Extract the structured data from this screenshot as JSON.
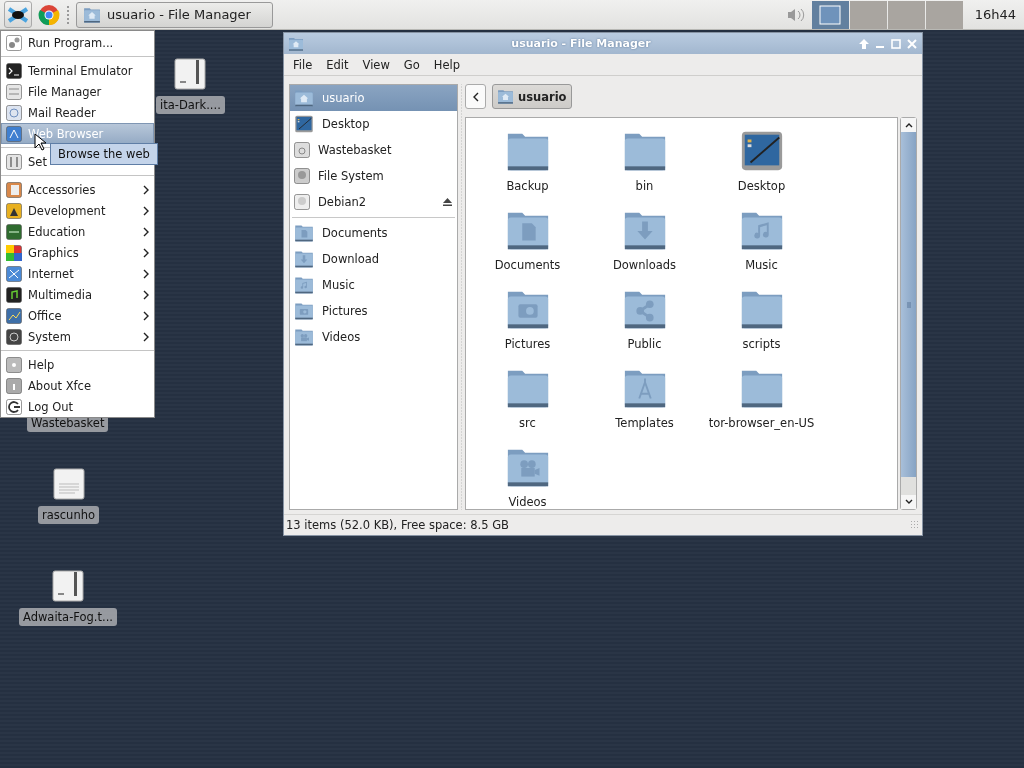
{
  "taskbar": {
    "task": {
      "label": "usuario - File Manager",
      "selected": false
    },
    "workspaces": [
      {
        "selected": true
      },
      {
        "selected": false
      },
      {
        "selected": false
      },
      {
        "selected": false
      }
    ],
    "clock": "16h44"
  },
  "desktop_icons": [
    {
      "label": "ita-Dark....",
      "kind": "archive"
    },
    {
      "label": "Wastebasket",
      "kind": "label"
    },
    {
      "label": "rascunho",
      "kind": "text"
    },
    {
      "label": "Adwaita-Fog.t...",
      "kind": "archive"
    }
  ],
  "menu": {
    "items": [
      {
        "kind": "item",
        "label": "Run Program...",
        "selected": false,
        "submenu": false
      },
      {
        "kind": "separator"
      },
      {
        "kind": "item",
        "label": "Terminal Emulator",
        "selected": false,
        "submenu": false
      },
      {
        "kind": "item",
        "label": "File Manager",
        "selected": false,
        "submenu": false
      },
      {
        "kind": "item",
        "label": "Mail Reader",
        "selected": false,
        "submenu": false
      },
      {
        "kind": "item",
        "label": "Web Browser",
        "selected": true,
        "submenu": false
      },
      {
        "kind": "separator"
      },
      {
        "kind": "item",
        "label": "Set",
        "selected": false,
        "submenu": false
      },
      {
        "kind": "separator"
      },
      {
        "kind": "item",
        "label": "Accessories",
        "selected": false,
        "submenu": true
      },
      {
        "kind": "item",
        "label": "Development",
        "selected": false,
        "submenu": true
      },
      {
        "kind": "item",
        "label": "Education",
        "selected": false,
        "submenu": true
      },
      {
        "kind": "item",
        "label": "Graphics",
        "selected": false,
        "submenu": true
      },
      {
        "kind": "item",
        "label": "Internet",
        "selected": false,
        "submenu": true
      },
      {
        "kind": "item",
        "label": "Multimedia",
        "selected": false,
        "submenu": true
      },
      {
        "kind": "item",
        "label": "Office",
        "selected": false,
        "submenu": true
      },
      {
        "kind": "item",
        "label": "System",
        "selected": false,
        "submenu": true
      },
      {
        "kind": "separator"
      },
      {
        "kind": "item",
        "label": "Help",
        "selected": false,
        "submenu": false
      },
      {
        "kind": "item",
        "label": "About Xfce",
        "selected": false,
        "submenu": false
      },
      {
        "kind": "item",
        "label": "Log Out",
        "selected": false,
        "submenu": false
      }
    ],
    "tooltip": "Browse the web"
  },
  "window": {
    "title": "usuario - File Manager",
    "menubar": [
      "File",
      "Edit",
      "View",
      "Go",
      "Help"
    ],
    "sidebar": {
      "devices": [
        {
          "label": "usuario",
          "selected": true,
          "eject": false
        },
        {
          "label": "Desktop",
          "selected": false,
          "eject": false
        },
        {
          "label": "Wastebasket",
          "selected": false,
          "eject": false
        },
        {
          "label": "File System",
          "selected": false,
          "eject": false
        },
        {
          "label": "Debian2",
          "selected": false,
          "eject": true
        }
      ],
      "places": [
        {
          "label": "Documents",
          "selected": false
        },
        {
          "label": "Download",
          "selected": false
        },
        {
          "label": "Music",
          "selected": false
        },
        {
          "label": "Pictures",
          "selected": false
        },
        {
          "label": "Videos",
          "selected": false
        }
      ]
    },
    "path": "usuario",
    "items": [
      {
        "label": "Backup"
      },
      {
        "label": "bin"
      },
      {
        "label": "Desktop"
      },
      {
        "label": "Documents"
      },
      {
        "label": "Downloads"
      },
      {
        "label": "Music"
      },
      {
        "label": "Pictures"
      },
      {
        "label": "Public"
      },
      {
        "label": "scripts"
      },
      {
        "label": "src"
      },
      {
        "label": "Templates"
      },
      {
        "label": "tor-browser_en-US"
      },
      {
        "label": "Videos"
      }
    ],
    "status": "13 items (52.0 KB), Free space: 8.5 GB"
  }
}
